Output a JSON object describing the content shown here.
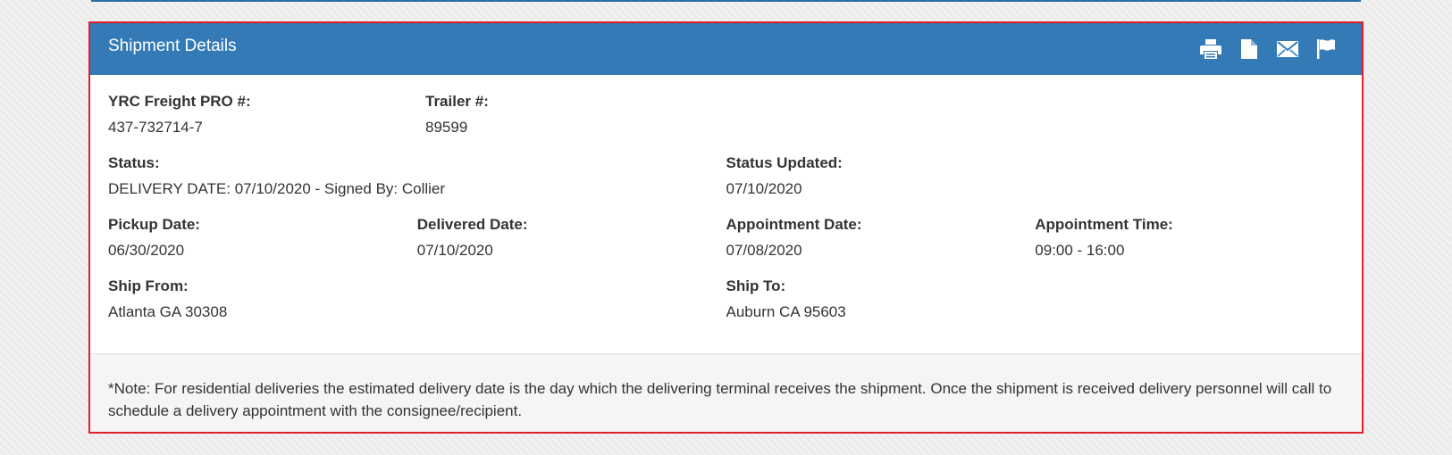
{
  "panel": {
    "title": "Shipment Details",
    "actions": [
      {
        "name": "print",
        "icon": "print-icon"
      },
      {
        "name": "document",
        "icon": "document-icon"
      },
      {
        "name": "email",
        "icon": "envelope-icon"
      },
      {
        "name": "flag",
        "icon": "flag-icon"
      }
    ]
  },
  "details": {
    "pro_label": "YRC Freight PRO #:",
    "pro_value": "437-732714-7",
    "trailer_label": "Trailer #:",
    "trailer_value": "89599",
    "status_label": "Status:",
    "status_value": "DELIVERY DATE: 07/10/2020 - Signed By: Collier",
    "status_updated_label": "Status Updated:",
    "status_updated_value": "07/10/2020",
    "pickup_label": "Pickup Date:",
    "pickup_value": "06/30/2020",
    "delivered_label": "Delivered Date:",
    "delivered_value": "07/10/2020",
    "appt_date_label": "Appointment Date:",
    "appt_date_value": "07/08/2020",
    "appt_time_label": "Appointment Time:",
    "appt_time_value": "09:00 - 16:00",
    "ship_from_label": "Ship From:",
    "ship_from_value": "Atlanta GA 30308",
    "ship_to_label": "Ship To:",
    "ship_to_value": "Auburn CA 95603"
  },
  "footer": {
    "note": "*Note: For residential deliveries the estimated delivery date is the day which the delivering terminal receives the shipment. Once the shipment is received delivery personnel will call to schedule a delivery appointment with the consignee/recipient."
  },
  "colors": {
    "header_bg": "#337ab7",
    "panel_border": "#e0202e",
    "footer_bg": "#f5f5f5"
  }
}
